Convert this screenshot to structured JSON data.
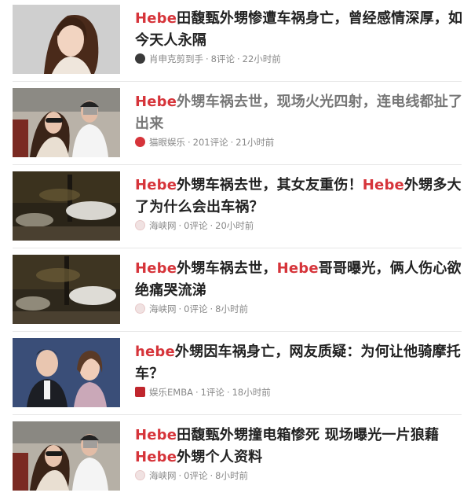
{
  "items": [
    {
      "title": [
        {
          "text": "Hebe",
          "hl": true
        },
        {
          "text": "田馥甄外甥惨遭车祸身亡，曾经感情深厚，如今天人永隔",
          "hl": false
        }
      ],
      "source": "肖申克剪到手",
      "comments": "8评论",
      "time": "22小时前",
      "source_icon": "avatar-icon"
    },
    {
      "title": [
        {
          "text": "Hebe",
          "hl": true
        },
        {
          "text": "外甥车祸去世，现场火光四射，连电线都扯了出来",
          "gray": true
        }
      ],
      "source": "猫眼娱乐",
      "comments": "201评论",
      "time": "21小时前",
      "source_icon": "cat-icon"
    },
    {
      "title": [
        {
          "text": "Hebe",
          "hl": true
        },
        {
          "text": "外甥车祸去世，其女友重伤！",
          "hl": false
        },
        {
          "text": "Hebe",
          "hl": true
        },
        {
          "text": "外甥多大了为什么会出车祸？",
          "hl": false
        }
      ],
      "source": "海峡网",
      "comments": "0评论",
      "time": "20小时前",
      "source_icon": "haixia-icon"
    },
    {
      "title": [
        {
          "text": "Hebe",
          "hl": true
        },
        {
          "text": "外甥车祸去世，",
          "hl": false
        },
        {
          "text": "Hebe",
          "hl": true
        },
        {
          "text": "哥哥曝光，俩人伤心欲绝痛哭流涕",
          "hl": false
        }
      ],
      "source": "海峡网",
      "comments": "0评论",
      "time": "8小时前",
      "source_icon": "haixia-icon"
    },
    {
      "title": [
        {
          "text": "hebe",
          "hl": true
        },
        {
          "text": "外甥因车祸身亡，网友质疑：为何让他骑摩托车？",
          "hl": false
        }
      ],
      "source": "娱乐EMBA",
      "comments": "1评论",
      "time": "18小时前",
      "source_icon": "emba-icon"
    },
    {
      "title": [
        {
          "text": "Hebe",
          "hl": true
        },
        {
          "text": "田馥甄外甥撞电箱惨死 现场曝光一片狼藉 ",
          "hl": false
        },
        {
          "text": "Hebe",
          "hl": true
        },
        {
          "text": "外甥个人资料",
          "hl": false
        }
      ],
      "source": "海峡网",
      "comments": "0评论",
      "time": "8小时前",
      "source_icon": "haixia-icon"
    }
  ]
}
